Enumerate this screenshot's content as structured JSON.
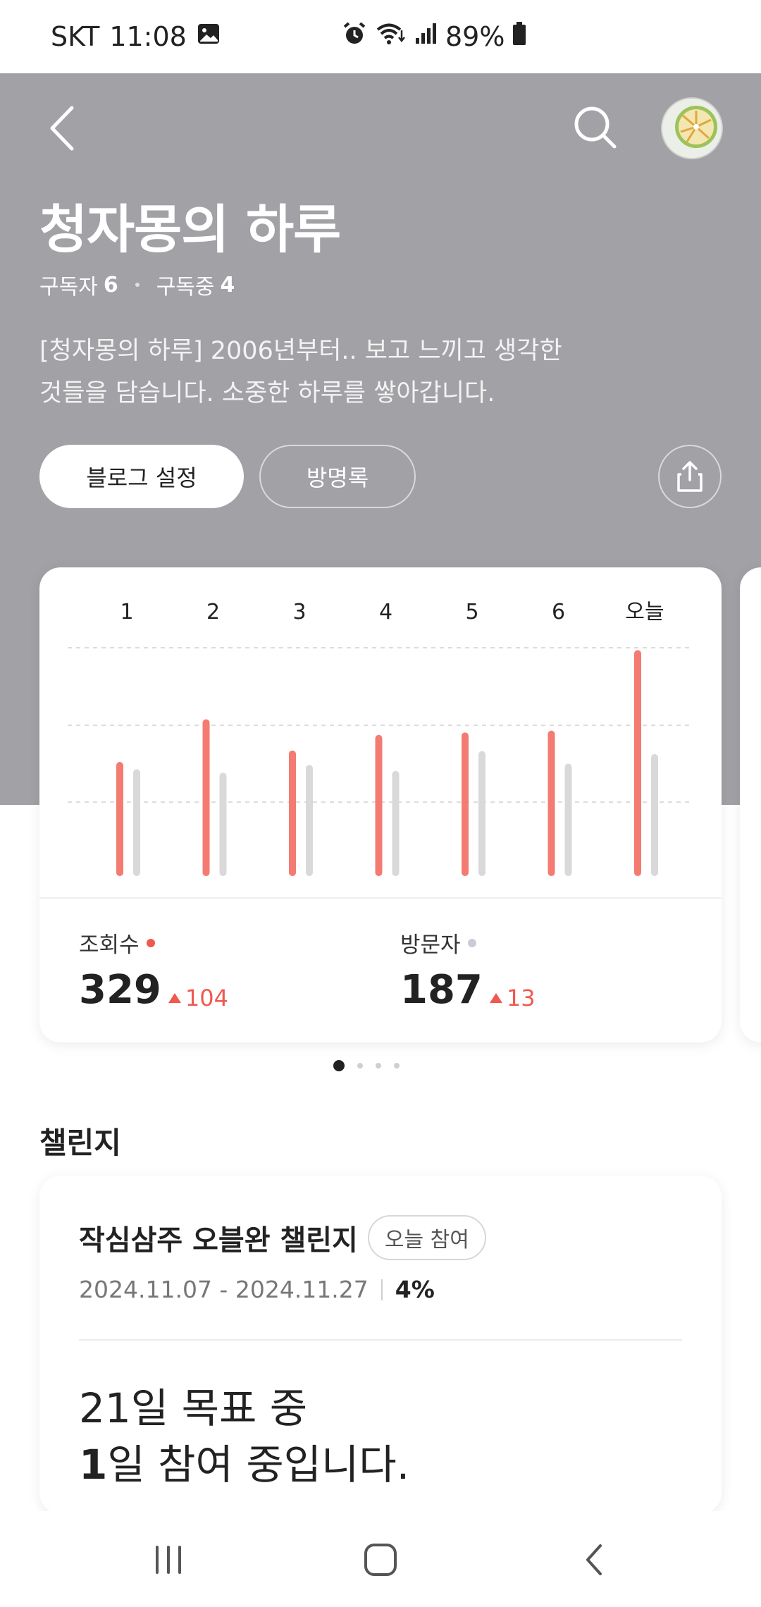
{
  "status_bar": {
    "carrier": "SKT",
    "time": "11:08",
    "battery": "89%",
    "icons": [
      "gallery-icon",
      "alarm-icon",
      "wifi-icon",
      "signal-icon",
      "battery-icon"
    ]
  },
  "header": {
    "title": "청자몽의 하루",
    "subscribers_label": "구독자",
    "subscribers_count": "6",
    "subscribing_label": "구독중",
    "subscribing_count": "4",
    "description_line1": "[청자몽의 하루] 2006년부터.. 보고 느끼고 생각한",
    "description_line2": "것들을 담습니다. 소중한 하루를 쌓아갑니다.",
    "settings_button": "블로그 설정",
    "guestbook_button": "방명록",
    "background_color": "#a1a1a6"
  },
  "chart_data": {
    "type": "bar",
    "categories": [
      "1",
      "2",
      "3",
      "4",
      "5",
      "6",
      "오늘"
    ],
    "series": [
      {
        "name": "조회수",
        "color": "#f47b72",
        "values": [
          190,
          261,
          209,
          235,
          239,
          242,
          376
        ]
      },
      {
        "name": "방문자",
        "color": "#d9d9d9",
        "values": [
          178,
          172,
          185,
          175,
          208,
          187,
          203
        ]
      }
    ],
    "ylim": [
      0,
      380
    ],
    "grid": true
  },
  "stats": {
    "views_label": "조회수",
    "views_value": "329",
    "views_delta": "104",
    "visitors_label": "방문자",
    "visitors_value": "187",
    "visitors_delta": "13",
    "views_color": "#f0594f",
    "visitors_color": "#c9ccd6"
  },
  "pager": {
    "count": 4,
    "active": 0
  },
  "challenge": {
    "section_title": "챌린지",
    "name": "작심삼주 오블완 챌린지",
    "badge": "오늘 참여",
    "dates": "2024.11.07 - 2024.11.27",
    "percent": "4%",
    "goal_line1": "21일 목표 중",
    "goal_count": "1",
    "goal_line2_rest": "일 참여 중입니다."
  },
  "nav": {
    "icons": [
      "recent-apps-icon",
      "home-icon",
      "back-icon"
    ]
  }
}
